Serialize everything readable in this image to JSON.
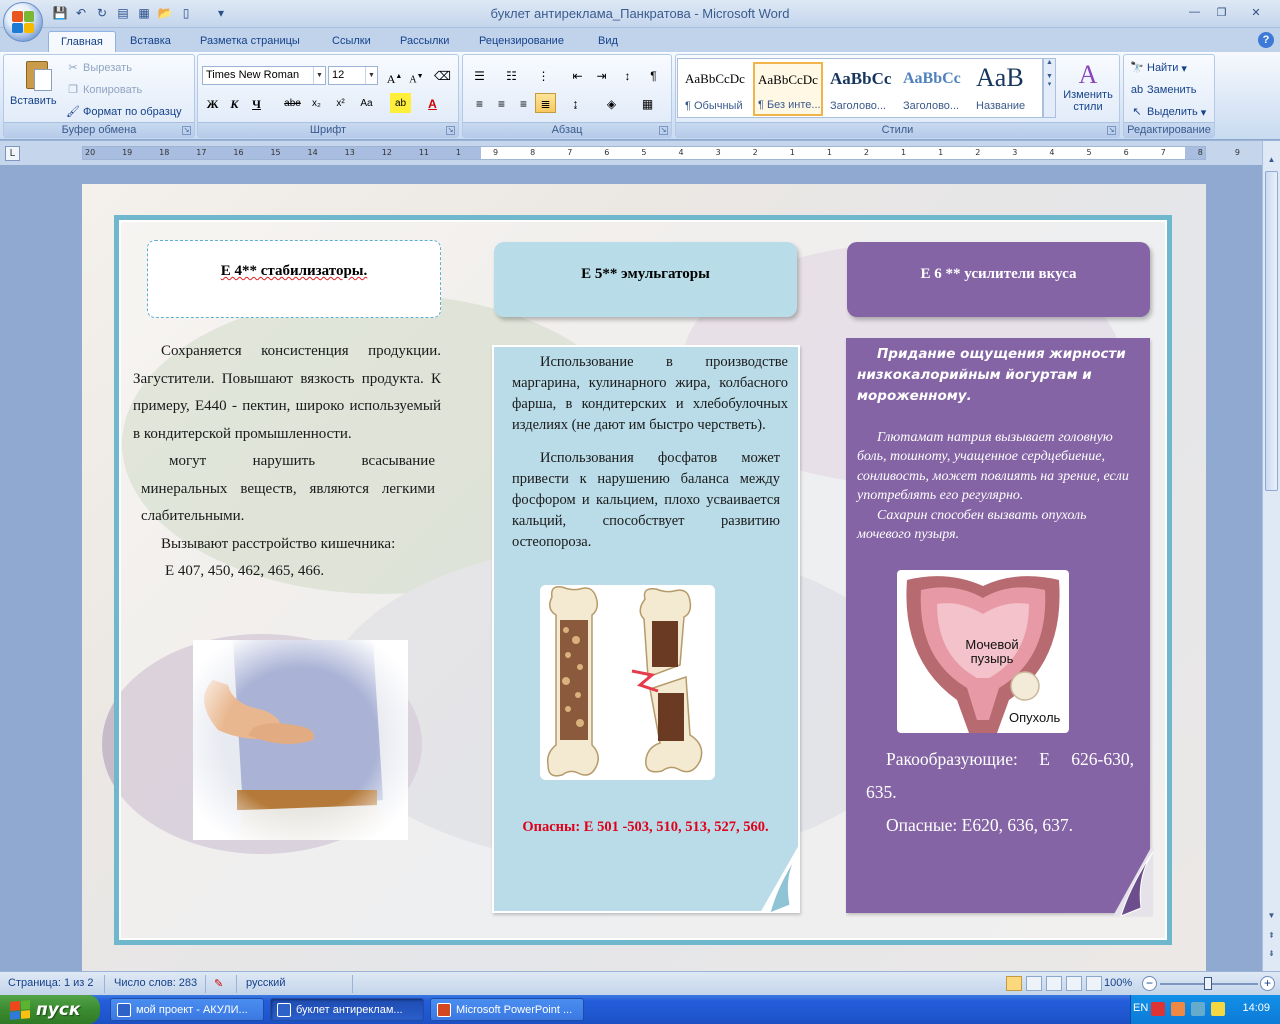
{
  "window": {
    "title": "буклет антиреклама_Панкратова - Microsoft Word",
    "controls": [
      "—",
      "❐",
      "✕"
    ]
  },
  "tabs": [
    "Главная",
    "Вставка",
    "Разметка страницы",
    "Ссылки",
    "Рассылки",
    "Рецензирование",
    "Вид"
  ],
  "ribbon": {
    "clipboard": {
      "label": "Буфер обмена",
      "paste": "Вставить",
      "cut": "Вырезать",
      "copy": "Копировать",
      "format_painter": "Формат по образцу"
    },
    "font": {
      "label": "Шрифт",
      "font_name": "Times New Roman",
      "font_size": "12"
    },
    "paragraph": {
      "label": "Абзац"
    },
    "styles": {
      "label": "Стили",
      "items": [
        {
          "sample": "AaBbCcDc",
          "name": "¶ Обычный"
        },
        {
          "sample": "AaBbCcDc",
          "name": "¶ Без инте..."
        },
        {
          "sample": "AaBbCc",
          "name": "Заголово..."
        },
        {
          "sample": "AaBbCc",
          "name": "Заголово..."
        },
        {
          "sample": "AaB",
          "name": "Название"
        }
      ],
      "change_styles": "Изменить стили"
    },
    "editing": {
      "label": "Редактирование",
      "find": "Найти",
      "replace": "Заменить",
      "select": "Выделить"
    }
  },
  "ruler": [
    "20",
    "19",
    "18",
    "17",
    "16",
    "15",
    "14",
    "13",
    "12",
    "11",
    "1",
    "9",
    "8",
    "7",
    "6",
    "5",
    "4",
    "3",
    "2",
    "1",
    "1",
    "2",
    "1",
    "1",
    "2",
    "3",
    "4",
    "5",
    "6",
    "7",
    "8",
    "9"
  ],
  "document": {
    "col1": {
      "heading": "Е 4** стабилизаторы.",
      "p1": "Сохраняется консистенция продукции. Загустители. Повышают вязкость продукта. К примеру, Е440 - пектин, широко используемый в кондитерской промышленности.",
      "p2": "могут нарушить всасывание минеральных веществ, являются легкими слабительными.",
      "p3": "Вызывают расстройство кишечника:",
      "p4": "Е 407, 450, 462, 465, 466."
    },
    "col2": {
      "heading": "Е 5** эмульгаторы",
      "p1": "Использование в производстве маргарина, кулинарного жира, колбасного фарша, в кондитерских и хлебобулочных изделиях (не дают им быстро черстветь).",
      "p2": "Использования фосфатов может привести к нарушению баланса между фосфором и кальцием, плохо усваивается кальций, способствует развитию остеопороза.",
      "danger": "Опасны: Е 501 -503, 510, 513, 527, 560."
    },
    "col3": {
      "heading": "Е 6 ** усилители вкуса",
      "title": "Придание ощущения жирности низкокалорийным йогуртам и мороженному.",
      "p1": "Глютамат натрия вызывает головную боль, тошноту, учащенное сердцебиение, сонливость, может повлиять на зрение, если употреблять его регулярно.",
      "p2": "Сахарин способен вызвать опухоль мочевого пузыря.",
      "img_label1": "Мочевой пузырь",
      "img_label2": "Опухоль",
      "p3": "Ракообразующие: Е 626-630, 635.",
      "p4": "Опасные: Е620, 636, 637."
    }
  },
  "statusbar": {
    "page": "Страница: 1 из 2",
    "words": "Число слов: 283",
    "language": "русский",
    "zoom": "100%"
  },
  "taskbar": {
    "start": "пуск",
    "items": [
      "мой проект - АКУЛИ...",
      "буклет антиреклам...",
      "Microsoft PowerPoint ..."
    ],
    "lang": "EN",
    "time": "14:09"
  }
}
